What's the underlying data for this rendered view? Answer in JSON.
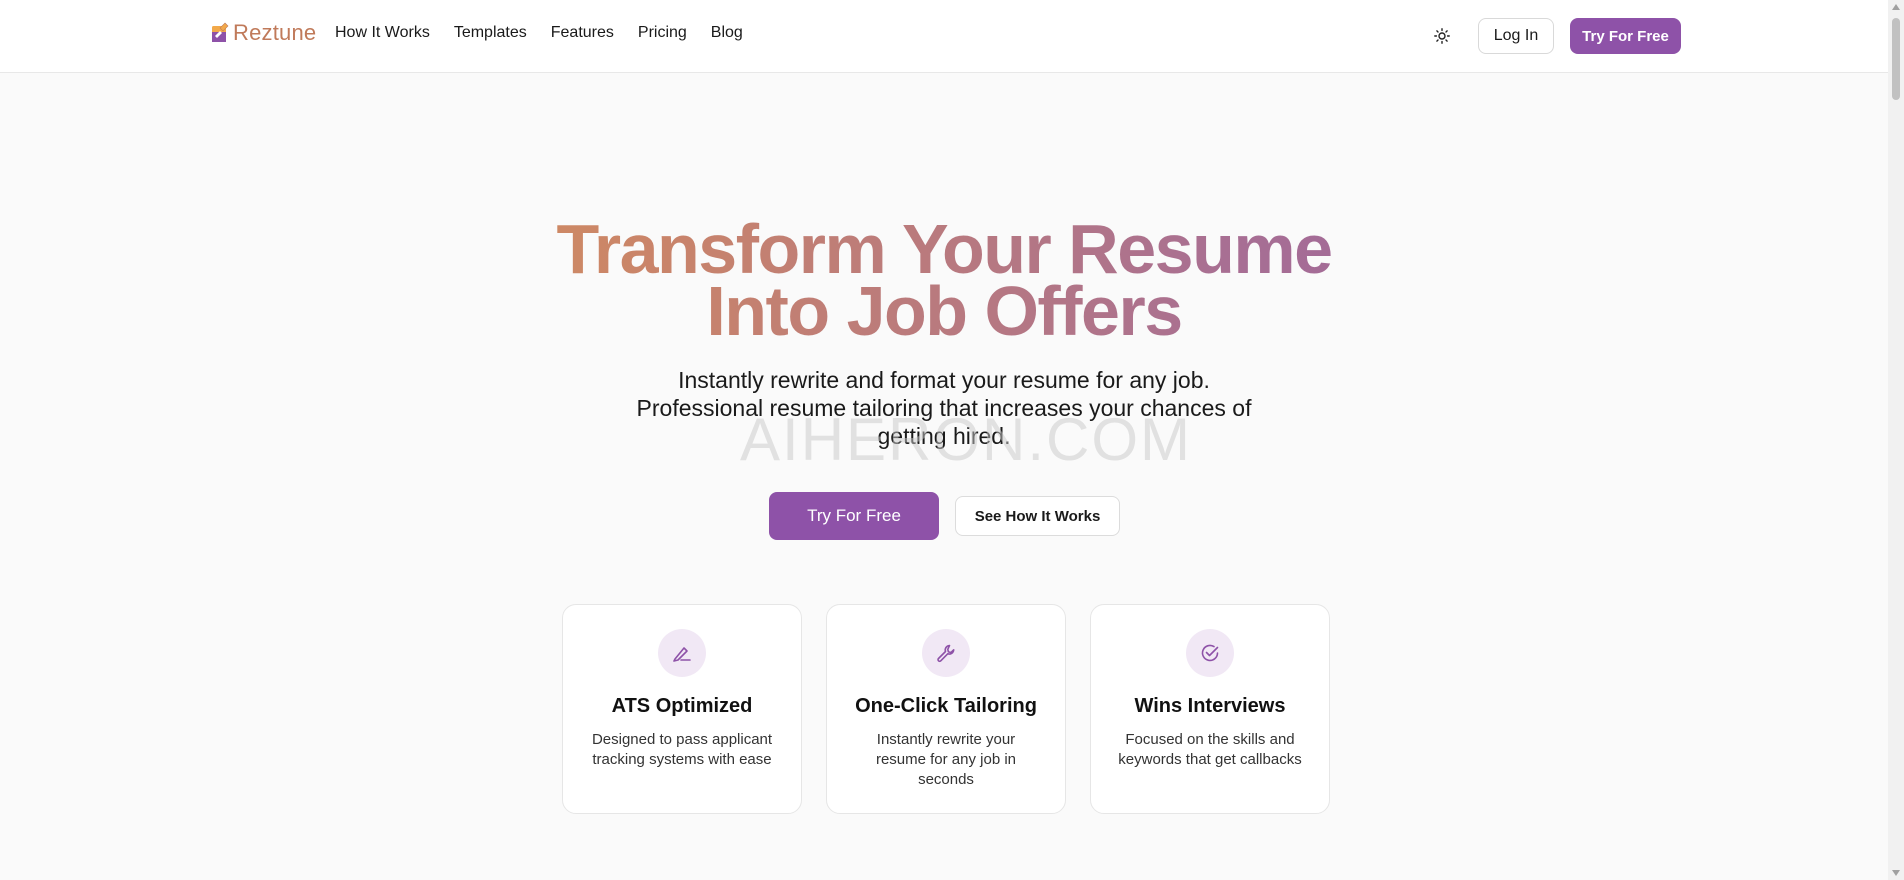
{
  "header": {
    "logo_text": "Reztune",
    "nav": [
      "How It Works",
      "Templates",
      "Features",
      "Pricing",
      "Blog"
    ],
    "login_label": "Log In",
    "try_label": "Try For Free"
  },
  "hero": {
    "title_line1": "Transform Your Resume",
    "title_line2": "Into Job Offers",
    "subtitle": "Instantly rewrite and format your resume for any job. Professional resume tailoring that increases your chances of getting hired.",
    "watermark": "AIHERON.COM",
    "primary_cta": "Try For Free",
    "secondary_cta": "See How It Works"
  },
  "features": [
    {
      "icon": "pen-icon",
      "title": "ATS Optimized",
      "description": "Designed to pass applicant tracking systems with ease"
    },
    {
      "icon": "wrench-icon",
      "title": "One-Click Tailoring",
      "description": "Instantly rewrite your resume for any job in seconds"
    },
    {
      "icon": "check-circle-icon",
      "title": "Wins Interviews",
      "description": "Focused on the skills and keywords that get callbacks"
    }
  ],
  "colors": {
    "accent": "#8e52a8",
    "gradient_start": "#e3a04b",
    "gradient_end": "#8e5aa8",
    "icon_bg": "#f1e8f5"
  }
}
